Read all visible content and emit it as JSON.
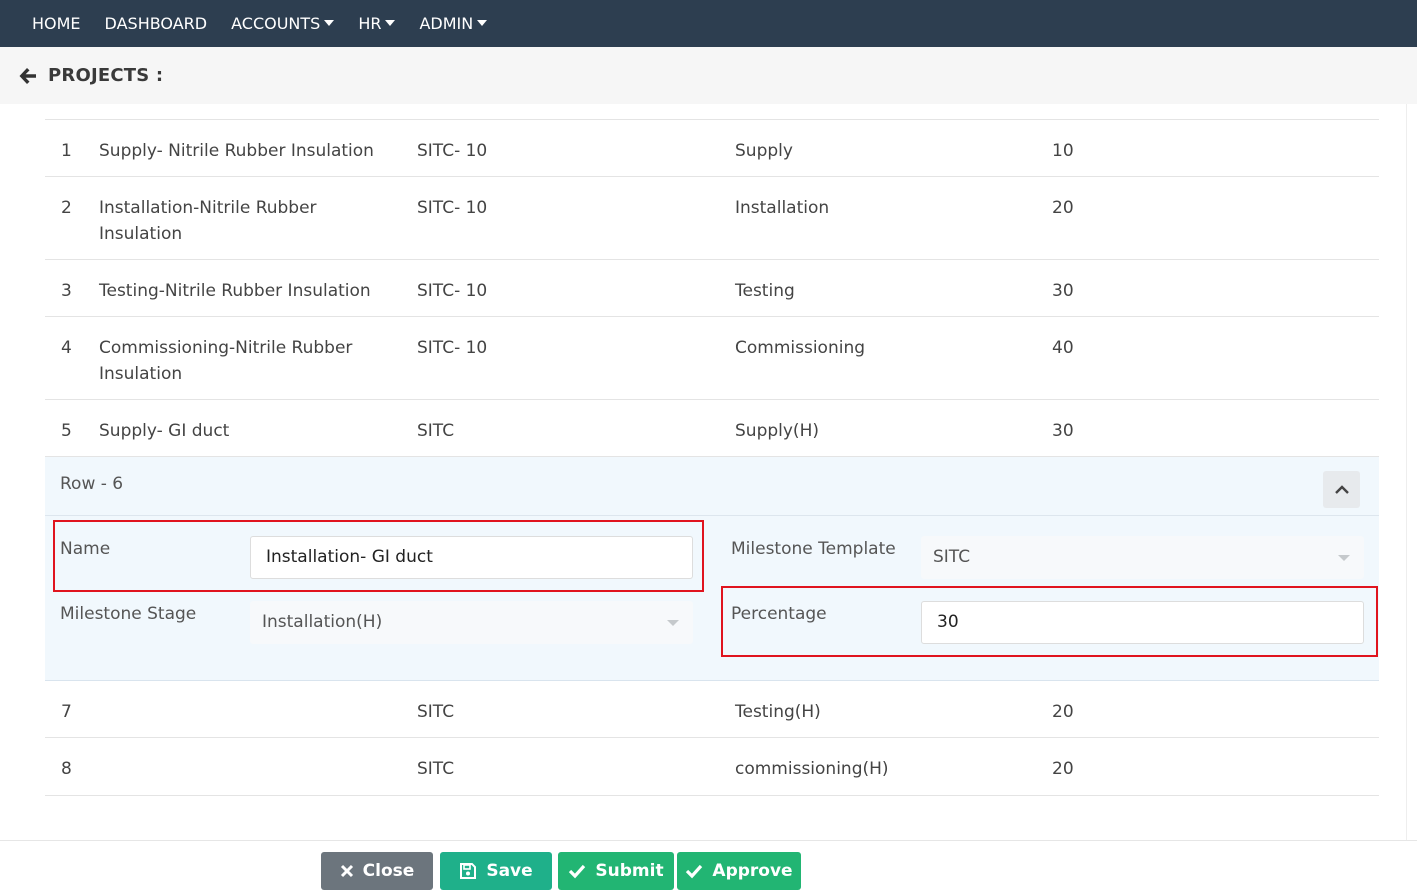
{
  "nav": {
    "items": [
      {
        "label": "HOME",
        "dropdown": false
      },
      {
        "label": "DASHBOARD",
        "dropdown": false
      },
      {
        "label": "ACCOUNTS",
        "dropdown": true
      },
      {
        "label": "HR",
        "dropdown": true
      },
      {
        "label": "ADMIN",
        "dropdown": true
      }
    ],
    "bg_color": "#2d3e50"
  },
  "page": {
    "title": "PROJECTS :",
    "back_icon": "arrow-left-icon"
  },
  "table": {
    "rows": [
      {
        "num": "1",
        "name": "Supply- Nitrile Rubber Insulation",
        "template": "SITC- 10",
        "stage": "Supply",
        "percentage": "10"
      },
      {
        "num": "2",
        "name": "Installation-Nitrile Rubber Insulation",
        "template": "SITC- 10",
        "stage": "Installation",
        "percentage": "20"
      },
      {
        "num": "3",
        "name": "Testing-Nitrile Rubber Insulation",
        "template": "SITC- 10",
        "stage": "Testing",
        "percentage": "30"
      },
      {
        "num": "4",
        "name": "Commissioning-Nitrile Rubber Insulation",
        "template": "SITC- 10",
        "stage": "Commissioning",
        "percentage": "40"
      },
      {
        "num": "5",
        "name": "Supply- GI duct",
        "template": "SITC",
        "stage": "Supply(H)",
        "percentage": "30"
      }
    ],
    "rows_after": [
      {
        "num": "7",
        "name": "",
        "template": "SITC",
        "stage": "Testing(H)",
        "percentage": "20"
      },
      {
        "num": "8",
        "name": "",
        "template": "SITC",
        "stage": "commissioning(H)",
        "percentage": "20"
      }
    ]
  },
  "edit_row": {
    "header": "Row - 6",
    "collapse_icon": "chevron-up-icon",
    "name_label": "Name",
    "name_value": "Installation- GI duct",
    "template_label": "Milestone Template",
    "template_value": "SITC",
    "stage_label": "Milestone Stage",
    "stage_value": "Installation(H)",
    "percentage_label": "Percentage",
    "percentage_value": "30",
    "highlight_color": "#e0141e"
  },
  "footer": {
    "close_label": "Close",
    "save_label": "Save",
    "submit_label": "Submit",
    "approve_label": "Approve",
    "close_icon": "times-icon",
    "save_icon": "floppy-disk-icon",
    "submit_icon": "check-icon",
    "approve_icon": "check-icon"
  }
}
